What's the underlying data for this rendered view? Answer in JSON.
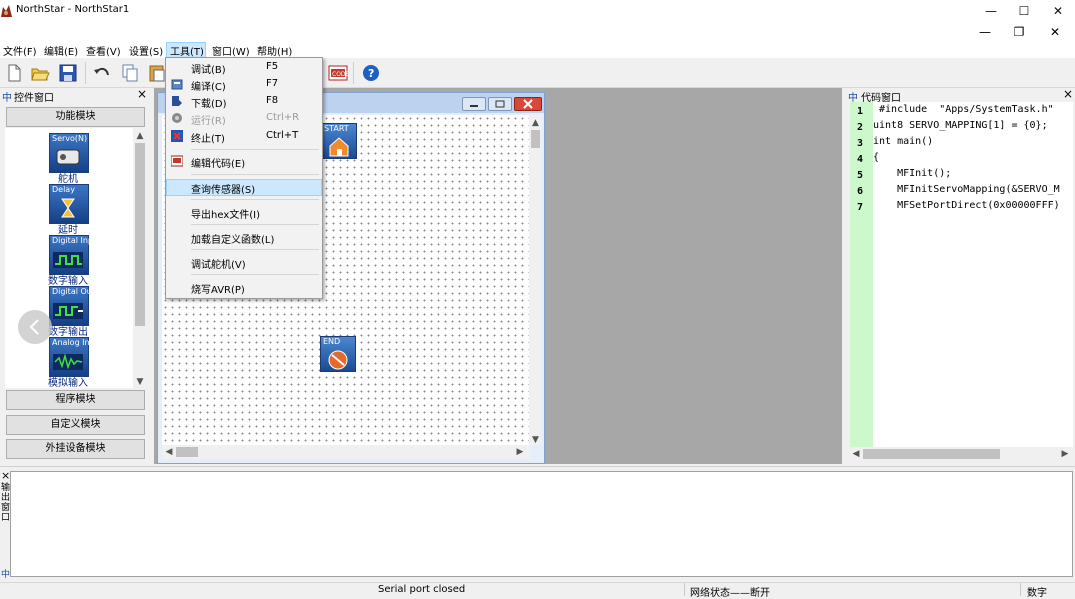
{
  "window": {
    "title": "NorthStar - NorthStar1",
    "min_glyph": "—",
    "max_glyph": "☐",
    "close_glyph": "✕",
    "restore_glyph": "❐"
  },
  "menubar": [
    "文件(F)",
    "编辑(E)",
    "查看(V)",
    "设置(S)",
    "工具(T)",
    "窗口(W)",
    "帮助(H)"
  ],
  "tools_menu": {
    "items": [
      {
        "label": "调试(B)",
        "shortcut": "F5",
        "enabled": true
      },
      {
        "label": "编译(C)",
        "shortcut": "F7",
        "enabled": true
      },
      {
        "label": "下载(D)",
        "shortcut": "F8",
        "enabled": true
      },
      {
        "label": "运行(R)",
        "shortcut": "Ctrl+R",
        "enabled": false
      },
      {
        "label": "终止(T)",
        "shortcut": "Ctrl+T",
        "enabled": true
      },
      {
        "label": "编辑代码(E)",
        "shortcut": "",
        "enabled": true
      },
      {
        "label": "查询传感器(S)",
        "shortcut": "",
        "enabled": true,
        "highlighted": true
      },
      {
        "label": "导出hex文件(I)",
        "shortcut": "",
        "enabled": true
      },
      {
        "label": "加载自定义函数(L)",
        "shortcut": "",
        "enabled": true
      },
      {
        "label": "调试舵机(V)",
        "shortcut": "",
        "enabled": true
      },
      {
        "label": "烧写AVR(P)",
        "shortcut": "",
        "enabled": true
      }
    ]
  },
  "left_panel": {
    "title": "控件窗口",
    "pin": "中",
    "close": "×",
    "groups": {
      "function": "功能模块",
      "program": "程序模块",
      "custom": "自定义模块",
      "external": "外挂设备模块"
    },
    "modules": [
      {
        "caption": "Servo(N)",
        "label": "舵机",
        "icon": "servo-icon"
      },
      {
        "caption": "Delay",
        "label": "延时",
        "icon": "hourglass-icon"
      },
      {
        "caption": "Digital Input",
        "label": "数字输入",
        "icon": "digital-input-icon"
      },
      {
        "caption": "Digital Output",
        "label": "数字输出",
        "icon": "digital-output-icon"
      },
      {
        "caption": "Analog Input",
        "label": "模拟输入",
        "icon": "analog-input-icon"
      }
    ]
  },
  "canvas": {
    "start_label": "START",
    "end_label": "END"
  },
  "code_panel": {
    "title": "代码窗口",
    "pin": "中",
    "close": "×",
    "line_numbers": [
      "1",
      "2",
      "3",
      "4",
      "5",
      "6",
      "7"
    ],
    "lines": [
      " #include  \"Apps/SystemTask.h\"",
      "uint8 SERVO_MAPPING[1] = {0};",
      "int main()",
      "{",
      "    MFInit();",
      "    MFInitServoMapping(&SERVO_M",
      "    MFSetPortDirect(0x00000FFF)"
    ]
  },
  "output_panel": {
    "title": "输出窗口",
    "close": "×",
    "pin": "中"
  },
  "statusbar": {
    "serial": "Serial port closed",
    "network": "网络状态——断开",
    "mode": "数字"
  },
  "colors": {
    "highlight": "#cce8ff",
    "code_gutter": "#ccf8cc",
    "mdi_background": "#a7a7a7",
    "close_button_red": "#d9483b"
  }
}
